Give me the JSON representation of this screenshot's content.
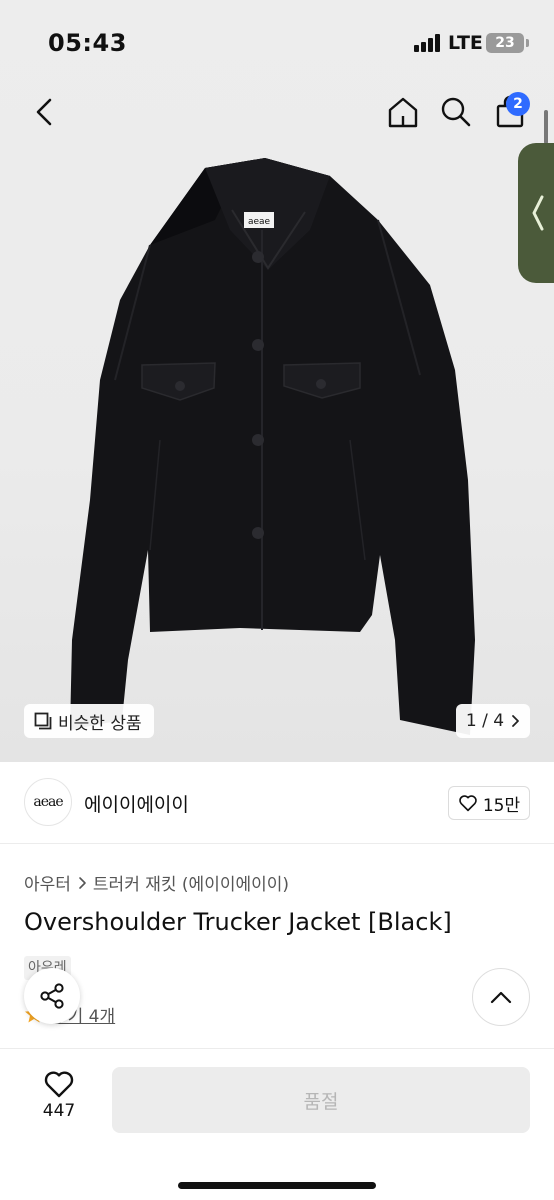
{
  "status_bar": {
    "time": "05:43",
    "network": "LTE",
    "battery": "23"
  },
  "nav": {
    "cart_count": "2"
  },
  "hero": {
    "similar_label": "비슷한 상품",
    "page_indicator": "1 / 4",
    "label_on_jacket": "aeae"
  },
  "brand": {
    "logo_text": "aeae",
    "name": "에이이에이이",
    "likes": "15만"
  },
  "product": {
    "breadcrumb": [
      "아우터",
      "트러커 재킷 (에이이에이이)"
    ],
    "title": "Overshoulder Trucker Jacket [Black]",
    "tag": "아우레",
    "reviews": "후기 4개"
  },
  "bottom_bar": {
    "wish_count": "447",
    "button_label": "품절"
  },
  "colors": {
    "accent": "#2f6bff",
    "side_handle": "#4b5a3a",
    "disabled_bg": "#ececec"
  },
  "icons": [
    "back-icon",
    "home-icon",
    "search-icon",
    "cart-icon",
    "chevron-left-icon",
    "similar-icon",
    "chevron-right-icon",
    "heart-icon",
    "share-icon",
    "chevron-up-icon",
    "star-icon"
  ]
}
